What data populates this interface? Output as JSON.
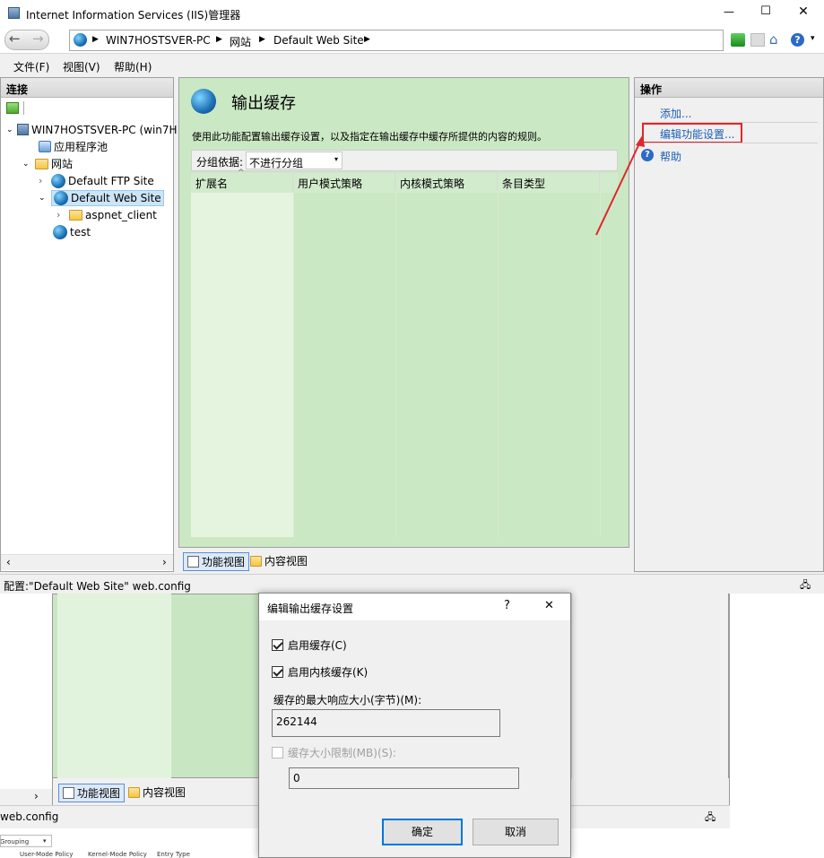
{
  "window": {
    "title": "Internet Information Services (IIS)管理器",
    "min_glyph": "—",
    "max_glyph": "☐",
    "close_glyph": "✕"
  },
  "address": {
    "breadcrumb": [
      "WIN7HOSTSVER-PC",
      "网站",
      "Default Web Site"
    ]
  },
  "menu": [
    "文件(F)",
    "视图(V)",
    "帮助(H)"
  ],
  "left": {
    "header": "连接",
    "tree": [
      {
        "label": "WIN7HOSTSVER-PC (win7H",
        "icon": "server-icon"
      },
      {
        "label": "应用程序池",
        "icon": "app-pool-icon"
      },
      {
        "label": "网站",
        "icon": "sites-folder-icon"
      },
      {
        "label": "Default FTP Site",
        "icon": "globe-icon"
      },
      {
        "label": "Default Web Site",
        "icon": "globe-icon"
      },
      {
        "label": "aspnet_client",
        "icon": "folder-icon"
      },
      {
        "label": "test",
        "icon": "globe-icon"
      }
    ]
  },
  "center": {
    "title": "输出缓存",
    "description": "使用此功能配置输出缓存设置，以及指定在输出缓存中缓存所提供的内容的规则。",
    "group_label": "分组依据:",
    "group_value": "不进行分组",
    "columns": [
      "扩展名",
      "用户模式策略",
      "内核模式策略",
      "条目类型"
    ],
    "tab_feature": "功能视图",
    "tab_content": "内容视图"
  },
  "right": {
    "header": "操作",
    "actions": [
      "添加...",
      "编辑功能设置...",
      "帮助"
    ]
  },
  "status": {
    "text": "配置:\"Default Web Site\" web.config"
  },
  "dialog": {
    "title": "编辑输出缓存设置",
    "help_glyph": "?",
    "close_glyph": "✕",
    "enable_cache": "启用缓存(C)",
    "enable_kernel_cache": "启用内核缓存(K)",
    "max_response_label": "缓存的最大响应大小(字节)(M):",
    "max_response_value": "262144",
    "cache_limit_label": "缓存大小限制(MB)(S):",
    "cache_limit_value": "0",
    "ok": "确定",
    "cancel": "取消"
  },
  "background": {
    "tab_feature": "功能视图",
    "tab_content": "内容视图",
    "status_text": "web.config",
    "mini_grouping": "Grouping",
    "mini_cols": [
      "User-Mode Policy",
      "Kernel-Mode Policy",
      "Entry Type"
    ]
  },
  "colors": {
    "highlight_red": "#e0262a",
    "green_panel": "#cbe8c4",
    "link_blue": "#1a5fb4"
  }
}
